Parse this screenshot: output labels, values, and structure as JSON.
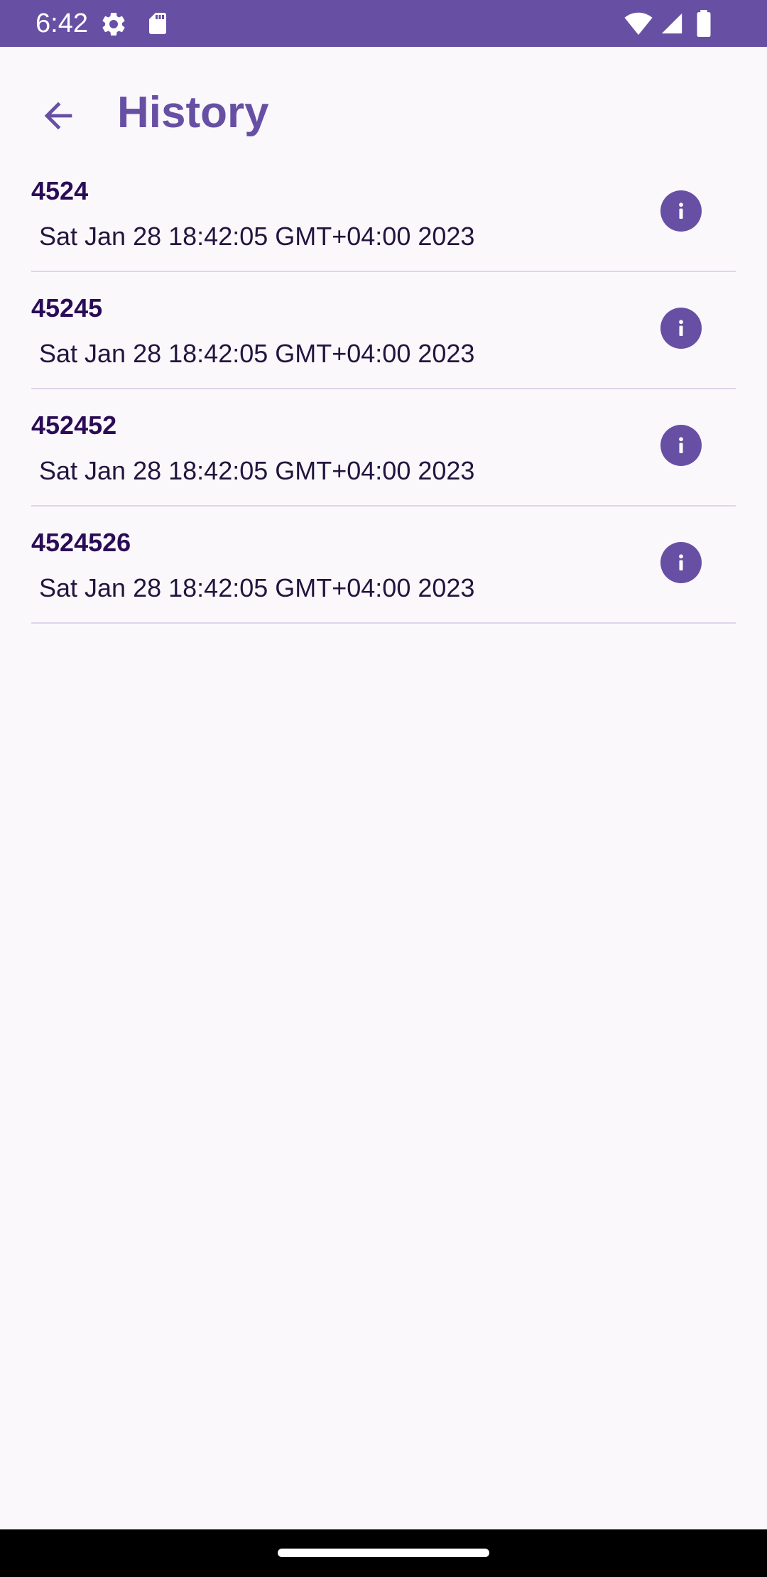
{
  "status_bar": {
    "time": "6:42",
    "icons_left": [
      "settings-icon",
      "sd-card-icon"
    ],
    "icons_right": [
      "wifi-icon",
      "cellular-signal-icon",
      "battery-icon"
    ],
    "background_color": "#6750a4"
  },
  "app_bar": {
    "back_icon": "arrow-back-icon",
    "title": "History",
    "accent_color": "#6750a4"
  },
  "history": {
    "items": [
      {
        "code": "4524",
        "date": " Sat Jan 28 18:42:05 GMT+04:00 2023",
        "icon": "info-icon"
      },
      {
        "code": "45245",
        "date": " Sat Jan 28 18:42:05 GMT+04:00 2023",
        "icon": "info-icon"
      },
      {
        "code": "452452",
        "date": " Sat Jan 28 18:42:05 GMT+04:00 2023",
        "icon": "info-icon"
      },
      {
        "code": "4524526",
        "date": " Sat Jan 28 18:42:05 GMT+04:00 2023",
        "icon": "info-icon"
      }
    ]
  }
}
